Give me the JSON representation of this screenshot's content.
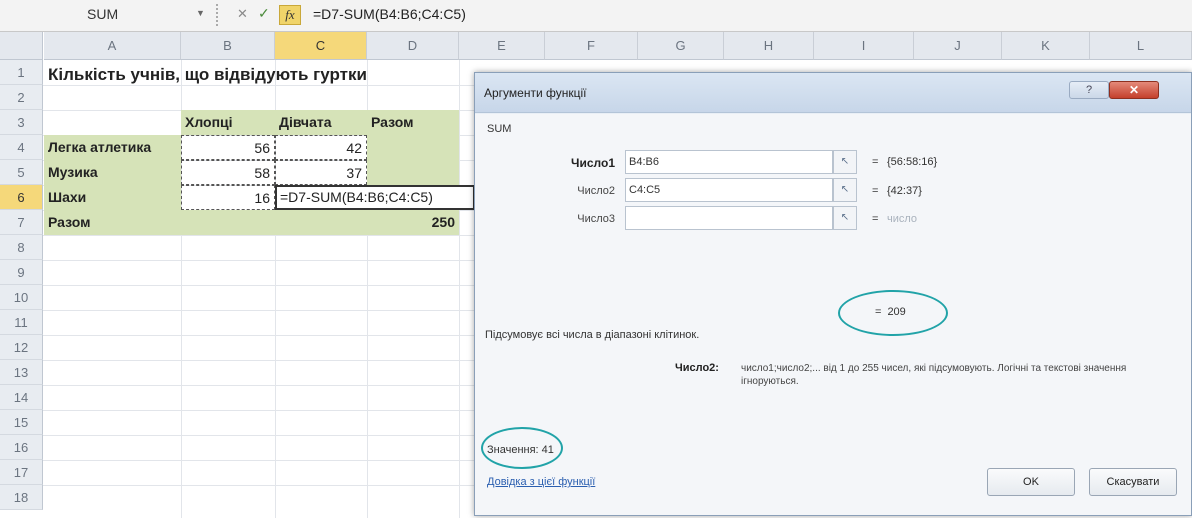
{
  "formula_bar": {
    "name_box": "SUM",
    "cancel_symbol": "✕",
    "enter_symbol": "✓",
    "fx_symbol": "fx",
    "formula": "=D7-SUM(B4:B6;C4:C5)"
  },
  "grid": {
    "columns": [
      "A",
      "B",
      "C",
      "D",
      "E",
      "F",
      "G",
      "H",
      "I",
      "J",
      "K",
      "L"
    ],
    "rows": [
      "1",
      "2",
      "3",
      "4",
      "5",
      "6",
      "7",
      "8",
      "9",
      "10",
      "11",
      "12",
      "13",
      "14",
      "15",
      "16",
      "17",
      "18"
    ],
    "title": "Кількість учнів, що відвідують гуртки",
    "headers": {
      "boys": "Хлопці",
      "girls": "Дівчата",
      "total": "Разом"
    },
    "row_labels": [
      "Легка атлетика",
      "Музика",
      "Шахи",
      "Разом"
    ],
    "boys_values": [
      "56",
      "58",
      "16"
    ],
    "girls_values": [
      "42",
      "37"
    ],
    "total_value": "250",
    "active_cell_text": "=D7-SUM(B4:B6;C4:C5)"
  },
  "dialog": {
    "title": "Аргументи функції",
    "help_button": "?",
    "close_button": "✕",
    "function_name": "SUM",
    "arguments": [
      {
        "label": "Число1",
        "value": "B4:B6",
        "result": "{56:58:16}"
      },
      {
        "label": "Число2",
        "value": "C4:C5",
        "result": "{42:37}"
      },
      {
        "label": "Число3",
        "value": "",
        "result": "число"
      }
    ],
    "ref_button_icon": "range-select-icon",
    "equals_sign": "=",
    "function_result": "209",
    "function_description": "Підсумовує всі числа в діапазоні клітинок.",
    "arg_description_label": "Число2:",
    "arg_description": "число1;число2;... від 1 до 255 чисел, які підсумовують. Логічні та текстові значення ігноруються.",
    "value_label": "Значення:",
    "value": "41",
    "help_link": "Довідка з цієї функції",
    "ok_button": "OK",
    "cancel_button": "Скасувати",
    "accent_color": "#21a3a8"
  }
}
